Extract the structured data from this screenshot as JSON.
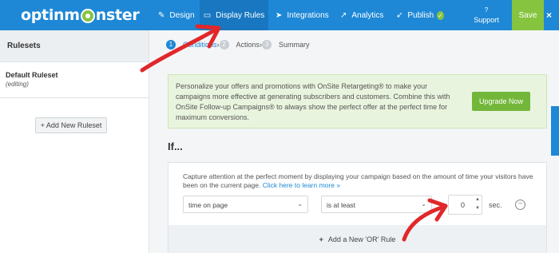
{
  "brand": {
    "logo_before": "optinm",
    "logo_after": "nster"
  },
  "nav": {
    "design": "Design",
    "display_rules": "Display Rules",
    "integrations": "Integrations",
    "analytics": "Analytics",
    "publish": "Publish",
    "support": "Support",
    "save": "Save",
    "close": "×"
  },
  "sidebar": {
    "heading": "Rulesets",
    "ruleset_name": "Default Ruleset",
    "ruleset_status": "(editing)",
    "add_button": "+ Add New Ruleset"
  },
  "steps": [
    {
      "num": "1",
      "label": "Conditions",
      "active": true
    },
    {
      "num": "2",
      "label": "Actions"
    },
    {
      "num": "3",
      "label": "Summary"
    }
  ],
  "promo": {
    "text": "Personalize your offers and promotions with OnSite Retargeting® to make your campaigns more effective at generating subscribers and customers. Combine this with OnSite Follow-up Campaigns® to always show the perfect offer at the perfect time for maximum conversions.",
    "button": "Upgrade Now"
  },
  "rules": {
    "heading": "If...",
    "description": "Capture attention at the perfect moment by displaying your campaign based on the amount of time your visitors have been on the current page.",
    "learn_more": "Click here to learn more »",
    "field": "time on page",
    "operator": "is at least",
    "value": "0",
    "unit": "sec.",
    "add_or": "Add a New 'OR' Rule"
  },
  "colors": {
    "brand_blue": "#1e88d6",
    "green": "#86c440",
    "annotation_red": "#e0282b"
  }
}
